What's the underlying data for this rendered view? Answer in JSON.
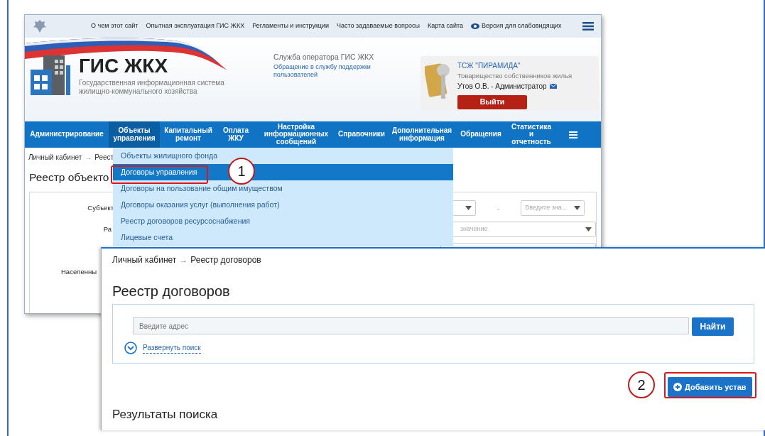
{
  "back_window": {
    "top_links": [
      "О чем этот сайт",
      "Опытная эксплуатация ГИС ЖКХ",
      "Регламенты и инструкции",
      "Часто задаваемые вопросы",
      "Карта сайта"
    ],
    "accessibility_link": "Версия для слабовидящих",
    "logo": {
      "title": "ГИС ЖКХ",
      "subtitle": "Государственная информационная система жилищно-коммунального хозяйства"
    },
    "operator": {
      "title": "Служба оператора ГИС ЖКХ",
      "link": "Обращение в службу поддержки пользователей"
    },
    "user": {
      "org_link": "ТСЖ \"ПИРАМИДА\"",
      "org_type": "Товарищество собственников жилья",
      "name": "Утов О.В. - Администратор",
      "logout": "Выйти"
    },
    "nav": [
      {
        "label": "Администрирование",
        "selected": false
      },
      {
        "label": "Объекты управления",
        "selected": true
      },
      {
        "label": "Капитальный ремонт",
        "selected": false
      },
      {
        "label": "Оплата ЖКУ",
        "selected": false
      },
      {
        "label": "Настройка информационных сообщений",
        "selected": false
      },
      {
        "label": "Справочники",
        "selected": false
      },
      {
        "label": "Дополнительная информация",
        "selected": false
      },
      {
        "label": "Обращения",
        "selected": false
      },
      {
        "label": "Статистика и отчетность",
        "selected": false
      }
    ],
    "breadcrumb": {
      "link": "Личный кабинет",
      "separator": "→",
      "current": "Реест"
    },
    "page_title": "Реестр объекто",
    "form_labels": [
      "Субъект",
      "Ра",
      "Населенны"
    ],
    "range_separator": "-",
    "range_to_placeholder": "Введите зна...",
    "second_field_value": "значение",
    "menu": [
      {
        "label": "Объекты жилищного фонда",
        "selected": false
      },
      {
        "label": "Договоры управления",
        "selected": true
      },
      {
        "label": "Договоры на пользование общим имуществом",
        "selected": false
      },
      {
        "label": "Договоры оказания услуг (выполнения работ)",
        "selected": false
      },
      {
        "label": "Реестр договоров ресурсоснабжения",
        "selected": false
      },
      {
        "label": "Лицевые счета",
        "selected": false
      }
    ]
  },
  "front_window": {
    "breadcrumb": {
      "link": "Личный кабинет",
      "separator": "→",
      "current": "Реестр договоров"
    },
    "page_title": "Реестр договоров",
    "search": {
      "placeholder": "Введите адрес",
      "button": "Найти",
      "expand_link": "Развернуть поиск"
    },
    "add_button": "Добавить устав",
    "results_title": "Результаты поиска"
  },
  "callouts": [
    "1",
    "2"
  ]
}
